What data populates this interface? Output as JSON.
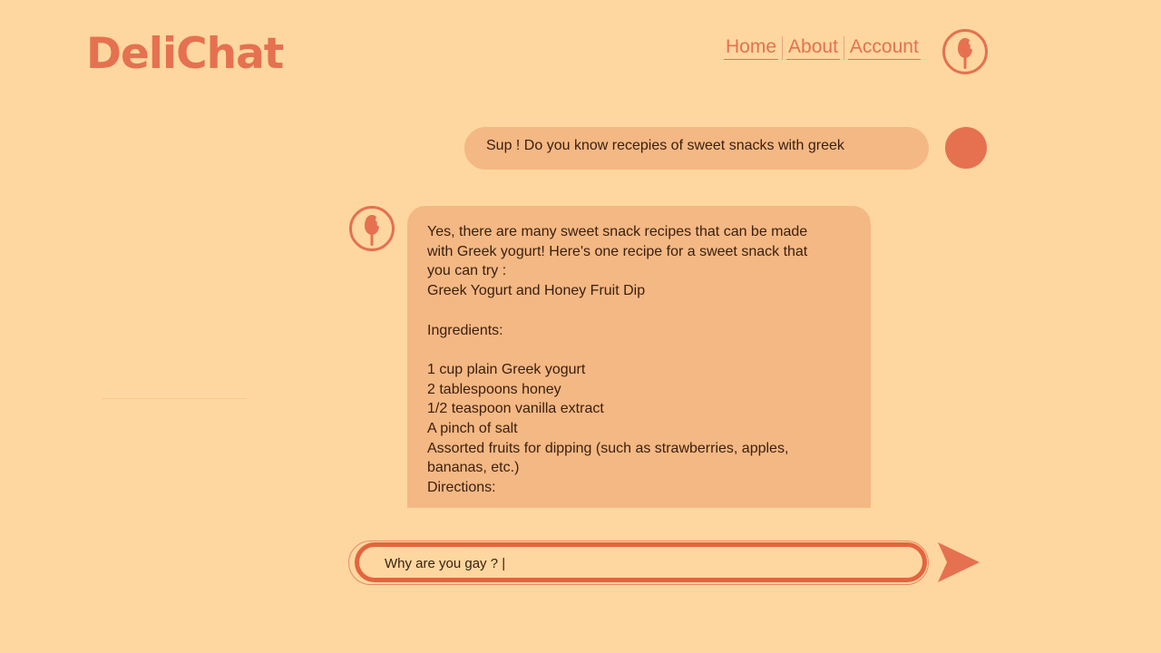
{
  "app": {
    "brand": "DeliChat"
  },
  "nav": {
    "items": [
      {
        "label": "Home"
      },
      {
        "label": "About"
      },
      {
        "label": "Account"
      }
    ],
    "logo_icon": "spoon-bite-icon"
  },
  "chat": {
    "user_message": "Sup ! Do you know recepies of sweet snacks with greek",
    "bot_icon": "spoon-bite-icon",
    "bot_message_lines": [
      "Yes, there are many sweet snack recipes that can be made",
      "with Greek yogurt! Here's one recipe for a sweet snack that",
      "you can try :",
      "Greek Yogurt and Honey Fruit Dip",
      "",
      "Ingredients:",
      "",
      "1 cup plain Greek yogurt",
      "2 tablespoons honey",
      "1/2 teaspoon vanilla extract",
      "A pinch of salt",
      "Assorted fruits for dipping (such as strawberries, apples,",
      "bananas, etc.)",
      "Directions:"
    ]
  },
  "composer": {
    "value": "Why are you gay ? |",
    "send_icon": "send-triangle-icon"
  },
  "colors": {
    "background": "#fdd79f",
    "accent": "#e57150",
    "bubble": "#f4b884",
    "text": "#3b2010"
  }
}
